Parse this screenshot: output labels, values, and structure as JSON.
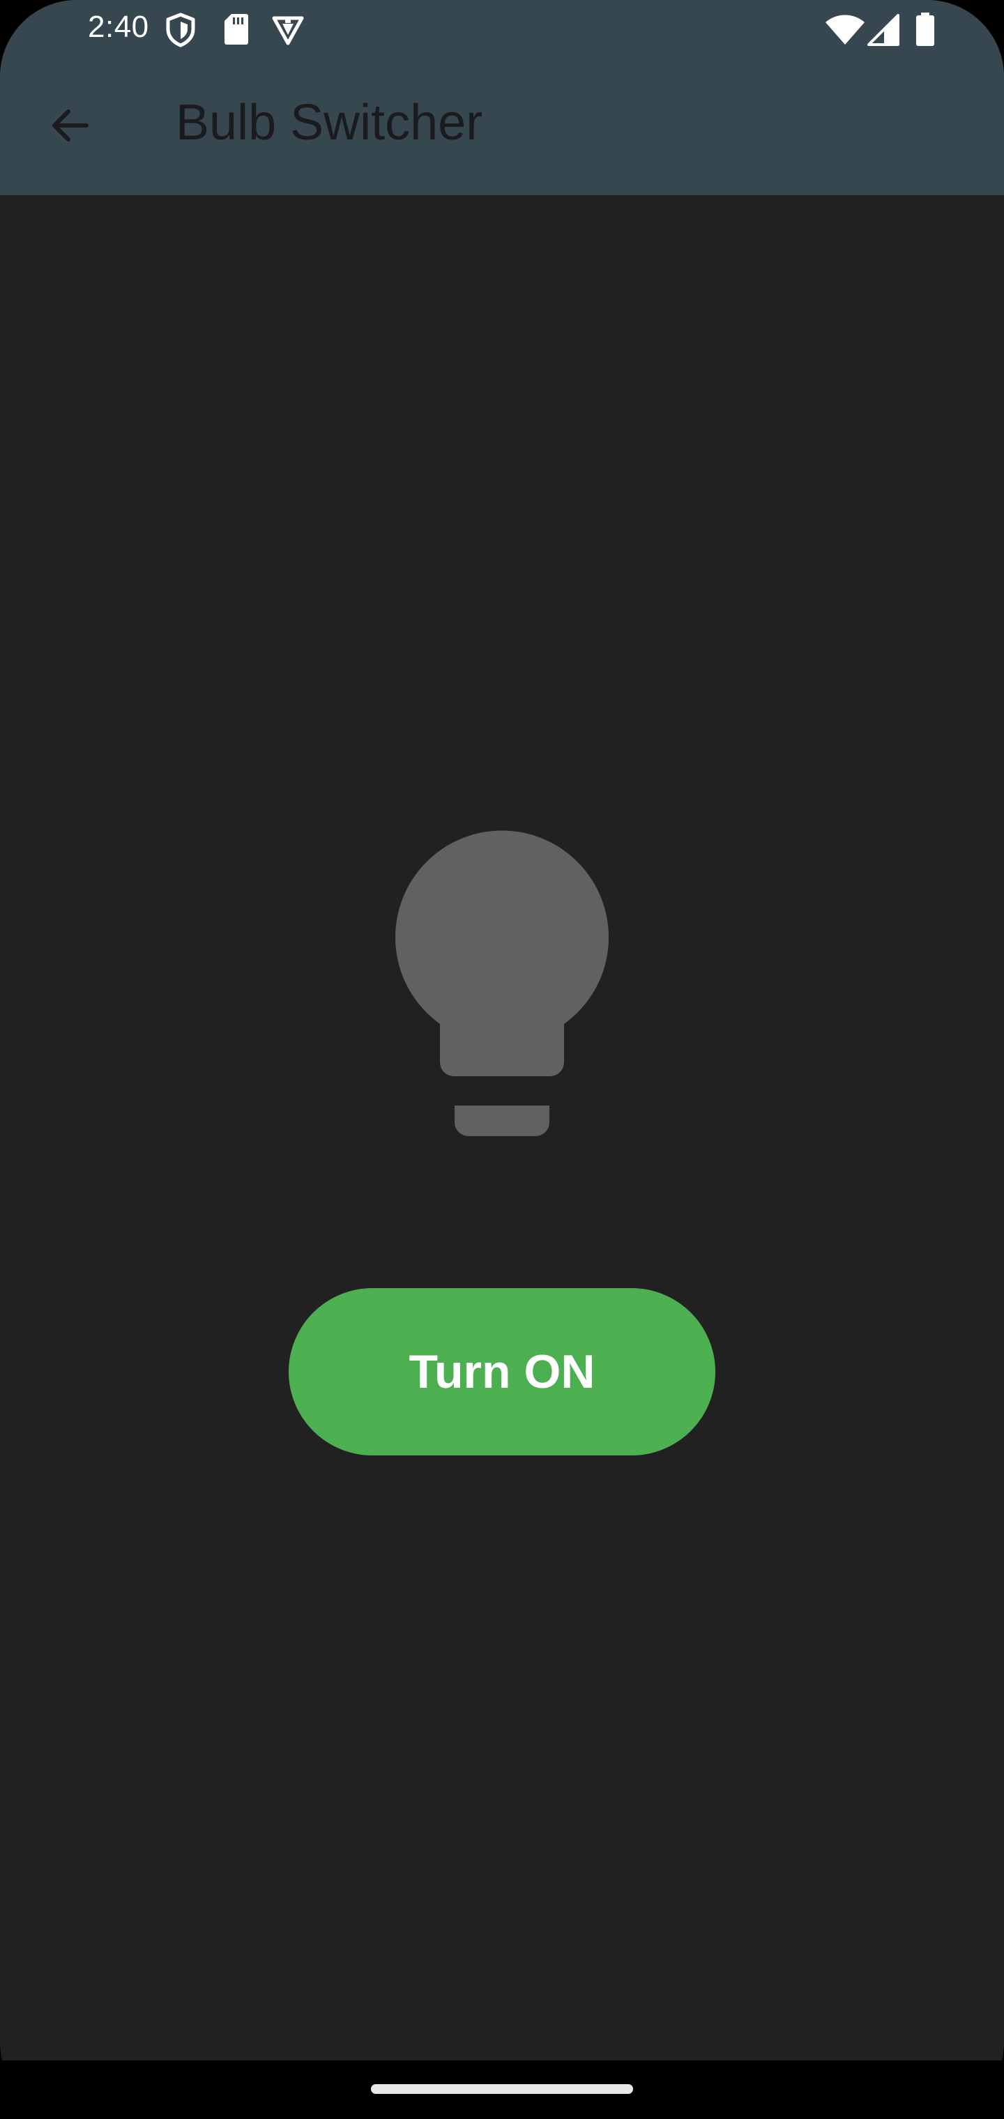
{
  "status_bar": {
    "time": "2:40",
    "left_icons": [
      "shield-icon",
      "sd-card-icon",
      "vpn-badge-icon"
    ],
    "right_icons": [
      "wifi-icon",
      "cell-signal-icon",
      "battery-icon"
    ]
  },
  "app_bar": {
    "title": "Bulb Switcher",
    "back_icon": "arrow-back-icon",
    "background": "#37474F"
  },
  "main": {
    "background": "#212121",
    "bulb": {
      "icon": "lightbulb-icon",
      "state": "off",
      "color": "#616161"
    },
    "toggle_button": {
      "label": "Turn ON",
      "color": "#4CAF50"
    }
  }
}
